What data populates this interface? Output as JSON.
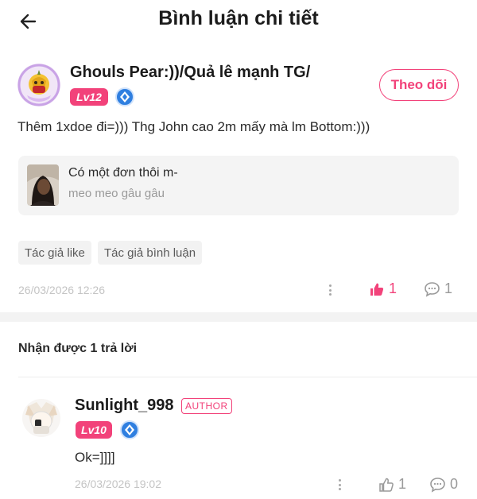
{
  "header": {
    "title": "Bình luận chi tiết",
    "back_icon": "arrow-left-icon"
  },
  "post": {
    "author_name": "Ghouls Pear:))/Quả lê mạnh TG/",
    "level": "Lv12",
    "follow_label": "Theo dõi",
    "content": "Thêm 1xdoe đi=))) Thg John cao 2m mấy mà lm Bottom:)))",
    "quote": {
      "title": "Có một đơn thôi m-",
      "subtitle": "meo meo gâu gâu"
    },
    "tags": [
      "Tác giả like",
      "Tác giả bình luận"
    ],
    "timestamp": "26/03/2026 12:26",
    "likes": "1",
    "comments": "1",
    "liked": true
  },
  "replies": {
    "title": "Nhận được 1 trả lời",
    "items": [
      {
        "author_name": "Sunlight_998",
        "author_badge": "AUTHOR",
        "level": "Lv10",
        "content": "Ok=]]]]",
        "timestamp": "26/03/2026 19:02",
        "likes": "1",
        "comments": "0"
      }
    ]
  },
  "colors": {
    "accent": "#f2427a",
    "verify": "#2f7fe0",
    "muted": "#c4c4c4"
  }
}
